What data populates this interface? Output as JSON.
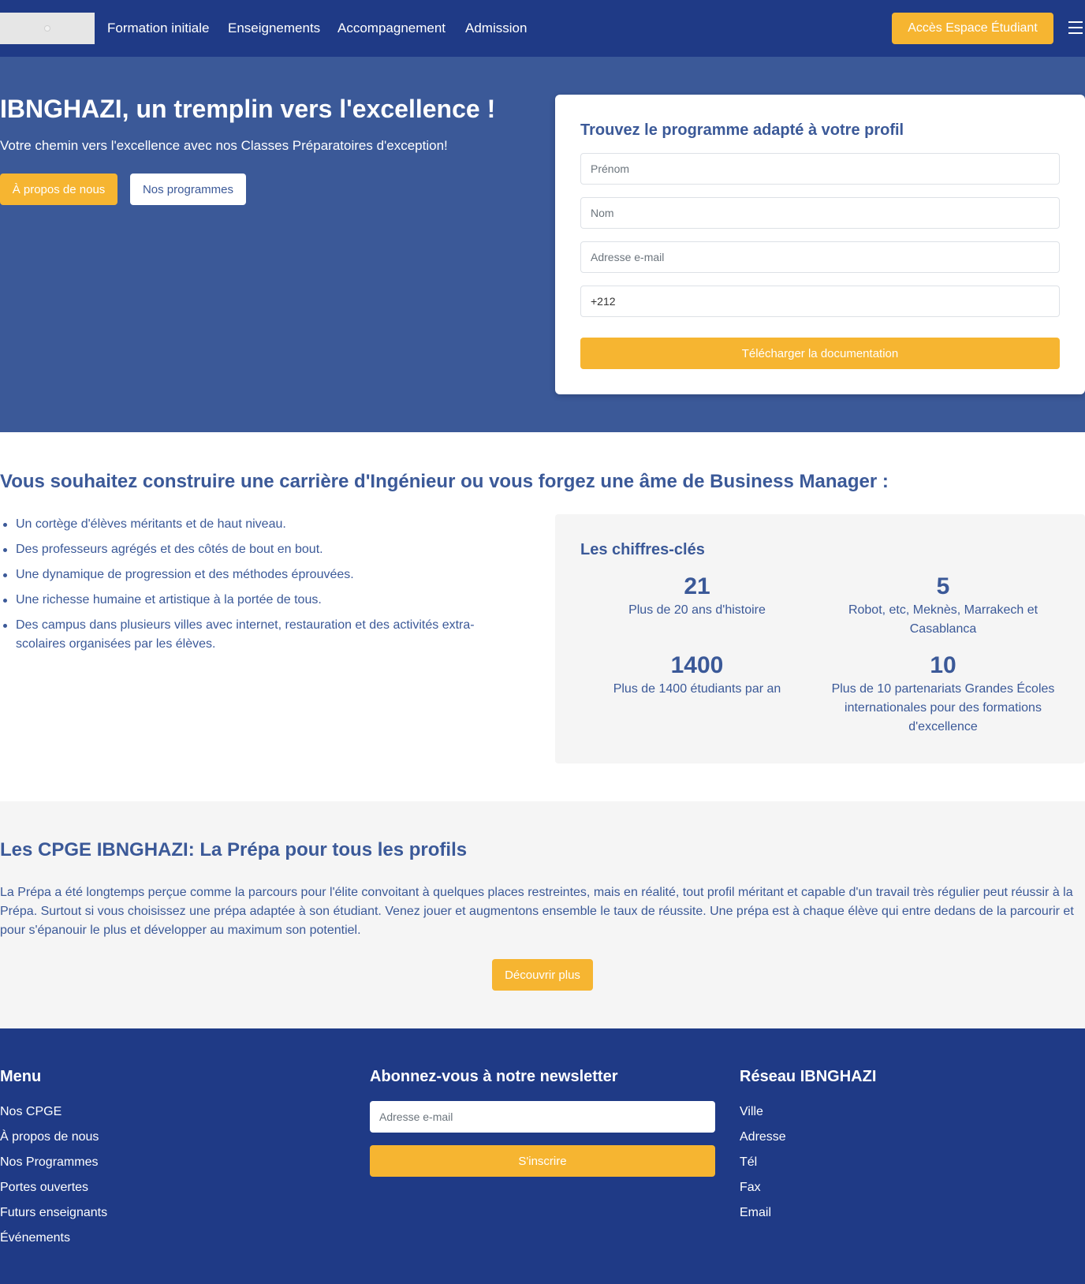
{
  "colors": {
    "navy": "#1f3a86",
    "blue": "#3b5998",
    "accent": "#f6b531",
    "light_gray": "#f5f5f5"
  },
  "nav": {
    "links": [
      "Formation initiale",
      "Enseignements",
      "Accompagnement",
      "Admission"
    ],
    "espace_button": "Accès Espace Étudiant",
    "menu_icon": "hamburger-menu-icon"
  },
  "hero": {
    "title": "IBNGHAZI, un tremplin vers l'excellence !",
    "subtitle": "Votre chemin vers l'excellence avec nos Classes Préparatoires d'exception!",
    "btn_about": "À propos de nous",
    "btn_programs": "Nos programmes"
  },
  "form": {
    "title": "Trouvez le programme adapté à votre profil",
    "prenom_placeholder": "Prénom",
    "nom_placeholder": "Nom",
    "email_placeholder": "Adresse e-mail",
    "phone_value": "+212",
    "submit": "Télécharger la documentation"
  },
  "carriere": {
    "title": "Vous souhaitez construire une carrière d'Ingénieur ou vous forgez une âme de Business Manager :",
    "items": [
      "Un cortège d'élèves méritants et de haut niveau.",
      "Des professeurs agrégés et des côtés de bout en bout.",
      "Une dynamique de progression et des méthodes éprouvées.",
      "Une richesse humaine et artistique à la portée de tous.",
      "Des campus dans plusieurs villes avec internet, restauration et des activités extra-scolaires organisées par les élèves."
    ]
  },
  "stats": {
    "title": "Les chiffres-clés",
    "items": [
      {
        "number": "21",
        "label": "Plus de 20 ans d'histoire"
      },
      {
        "number": "5",
        "label": "Robot, etc, Meknès, Marrakech et Casablanca"
      },
      {
        "number": "1400",
        "label": "Plus de 1400 étudiants par an"
      },
      {
        "number": "10",
        "label": "Plus de 10 partenariats Grandes Écoles internationales pour des formations d'excellence"
      }
    ]
  },
  "cpge": {
    "title": "Les CPGE IBNGHAZI: La Prépa pour tous les profils",
    "text": "La Prépa a été longtemps perçue comme la parcours pour l'élite convoitant à quelques places restreintes, mais en réalité, tout profil méritant et capable d'un travail très régulier peut réussir à la Prépa. Surtout si vous choisissez une prépa adaptée à son étudiant. Venez jouer et augmentons ensemble le taux de réussite. Une prépa est à chaque élève qui entre dedans de la parcourir et pour s'épanouir le plus et développer au maximum son potentiel.",
    "button": "Découvrir plus"
  },
  "footer": {
    "menu_title": "Menu",
    "menu_items": [
      "Nos CPGE",
      "À propos de nous",
      "Nos Programmes",
      "Portes ouvertes",
      "Futurs enseignants",
      "Événements"
    ],
    "newsletter_title": "Abonnez-vous à notre newsletter",
    "newsletter_placeholder": "Adresse e-mail",
    "newsletter_button": "S'inscrire",
    "reseau_title": "Réseau IBNGHAZI",
    "reseau_items": [
      "Ville",
      "Adresse",
      "Tél",
      "Fax",
      "Email"
    ]
  }
}
